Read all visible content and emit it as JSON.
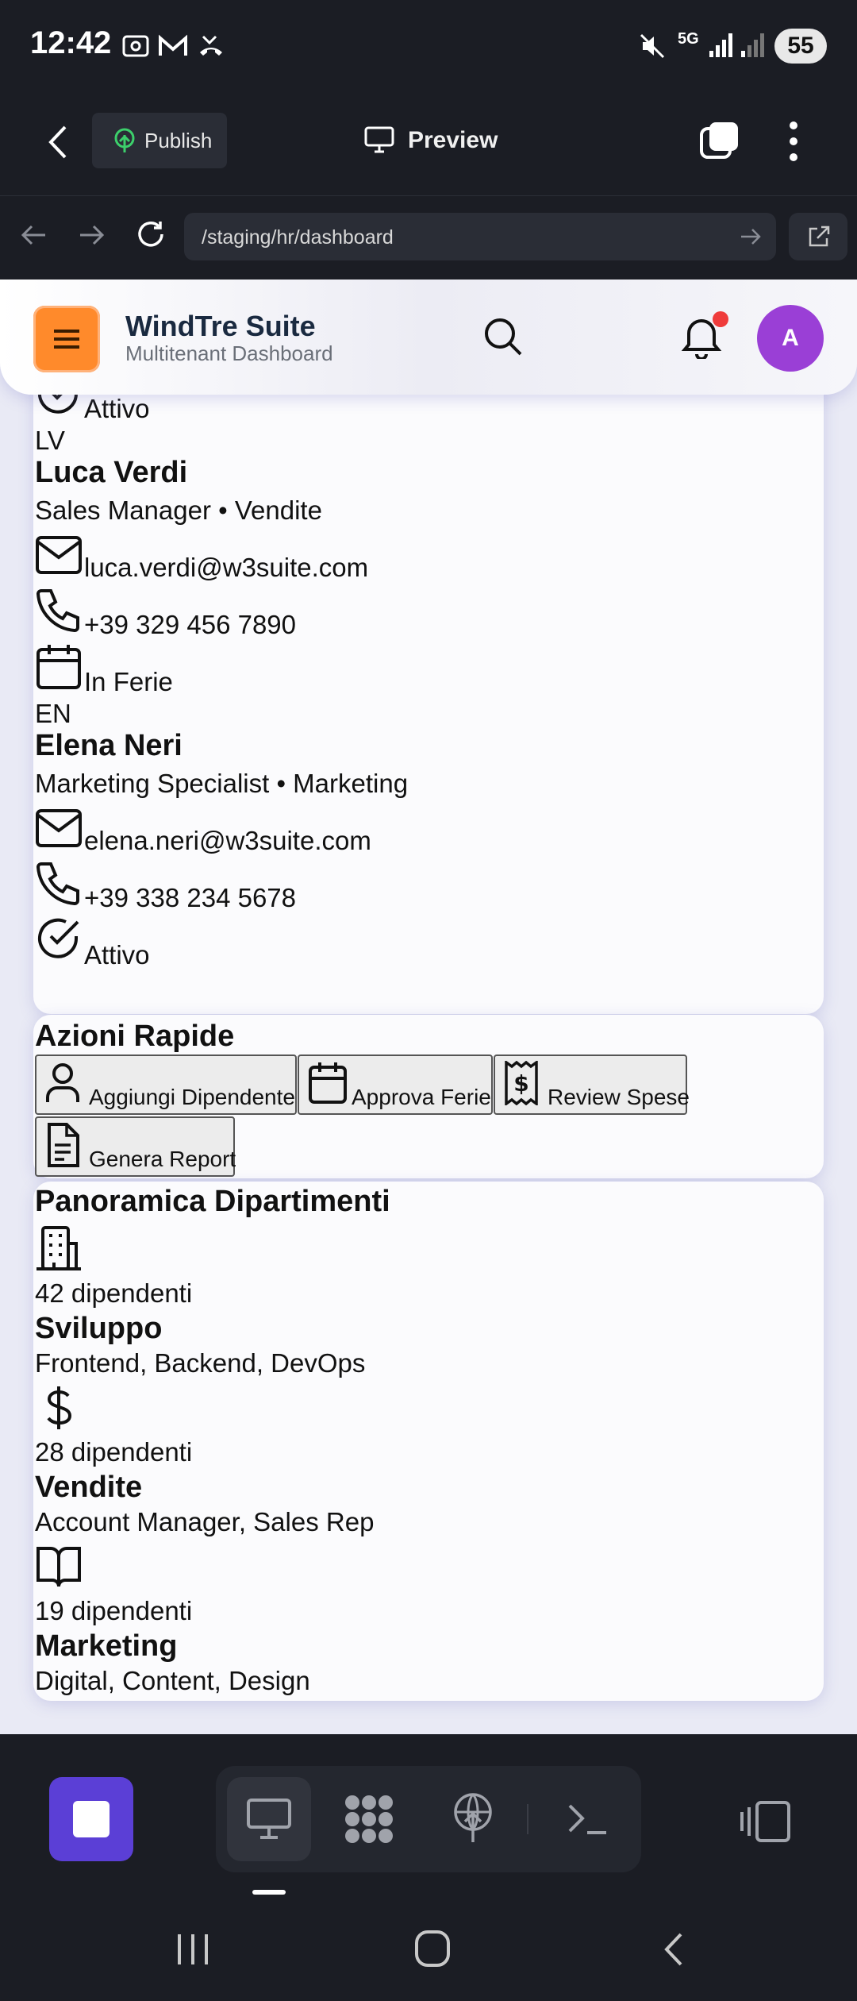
{
  "status_bar": {
    "time": "12:42",
    "battery": "55",
    "network": "5G"
  },
  "toolbar": {
    "publish_label": "Publish",
    "preview_label": "Preview"
  },
  "url_bar": {
    "url": "/staging/hr/dashboard"
  },
  "app_header": {
    "brand": "WindTre Suite",
    "subtitle": "Multitenant Dashboard",
    "avatar_initial": "A"
  },
  "employees": [
    {
      "status": "Attivo"
    },
    {
      "initials": "LV",
      "name": "Luca Verdi",
      "role": "Sales Manager • Vendite",
      "email": "luca.verdi@w3suite.com",
      "phone": "+39 329 456 7890",
      "status": "In Ferie"
    },
    {
      "initials": "EN",
      "name": "Elena Neri",
      "role": "Marketing Specialist • Marketing",
      "email": "elena.neri@w3suite.com",
      "phone": "+39 338 234 5678",
      "status": "Attivo"
    }
  ],
  "quick_actions": {
    "title": "Azioni Rapide",
    "buttons": [
      {
        "label": "Aggiungi Dipendente",
        "icon": "user-icon"
      },
      {
        "label": "Approva Ferie",
        "icon": "calendar-icon"
      },
      {
        "label": "Review Spese",
        "icon": "receipt-icon"
      },
      {
        "label": "Genera Report",
        "icon": "file-text-icon"
      }
    ]
  },
  "departments": {
    "title": "Panoramica Dipartimenti",
    "items": [
      {
        "count": "42 dipendenti",
        "name": "Sviluppo",
        "roles": "Frontend, Backend, DevOps",
        "icon": "building-icon"
      },
      {
        "count": "28 dipendenti",
        "name": "Vendite",
        "roles": "Account Manager, Sales Rep",
        "icon": "dollar-icon"
      },
      {
        "count": "19 dipendenti",
        "name": "Marketing",
        "roles": "Digital, Content, Design",
        "icon": "book-open-icon"
      }
    ]
  },
  "colors": {
    "accent_orange": "#ff8a2b",
    "avatar_purple": "#9a3fd6",
    "primary_purple": "#5b3fd6",
    "dark_bg": "#1b1d24",
    "notification_red": "#ef3b3b"
  }
}
